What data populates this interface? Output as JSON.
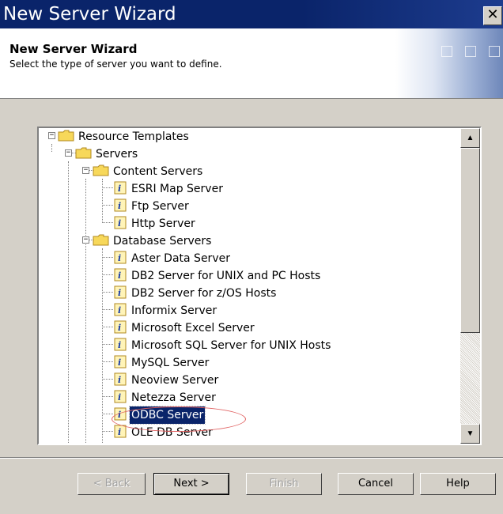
{
  "window": {
    "title": "New Server Wizard"
  },
  "header": {
    "title": "New Server Wizard",
    "subtitle": "Select the type of server you want to define."
  },
  "tree": {
    "root": "Resource Templates",
    "servers": "Servers",
    "content_servers": {
      "label": "Content Servers",
      "items": [
        "ESRI Map Server",
        "Ftp Server",
        "Http Server"
      ]
    },
    "database_servers": {
      "label": "Database Servers",
      "items": [
        "Aster Data Server",
        "DB2 Server for UNIX and PC Hosts",
        "DB2 Server for z/OS Hosts",
        "Informix Server",
        "Microsoft Excel Server",
        "Microsoft SQL Server for UNIX Hosts",
        "MySQL Server",
        "Neoview Server",
        "Netezza Server",
        "ODBC Server",
        "OLE DB Server"
      ]
    },
    "selected": "ODBC Server"
  },
  "buttons": {
    "back": "< Back",
    "next": "Next >",
    "finish": "Finish",
    "cancel": "Cancel",
    "help": "Help"
  },
  "colors": {
    "titlebar": "#0a246a",
    "selection": "#0a246a",
    "annotation": "#e06060",
    "folder": "#f7d85a"
  }
}
